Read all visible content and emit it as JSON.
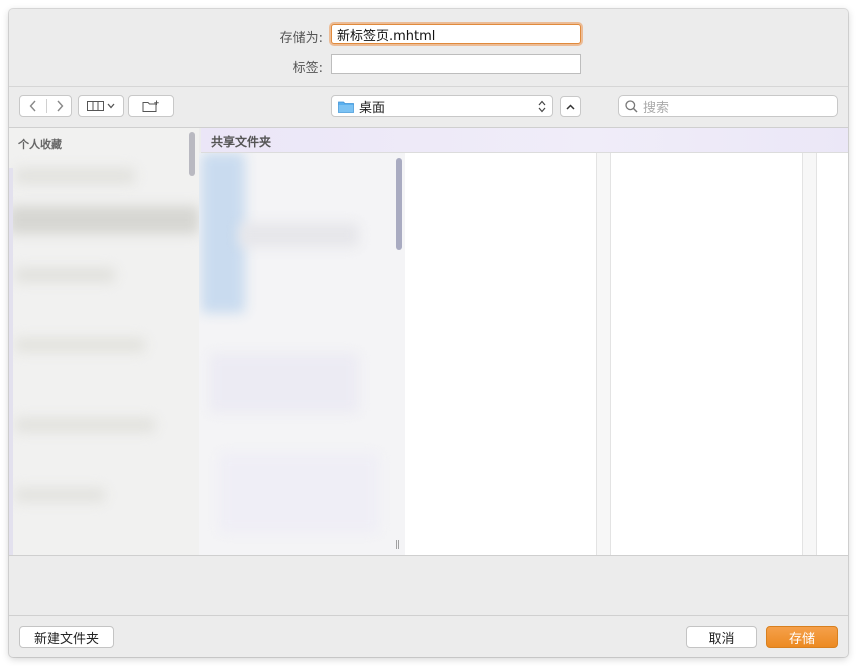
{
  "save_dialog": {
    "save_as_label": "存储为:",
    "save_as_value": "新标签页.mhtml",
    "tags_label": "标签:",
    "tags_value": ""
  },
  "toolbar": {
    "location": "桌面",
    "search_placeholder": "搜索"
  },
  "sidebar": {
    "section_title": "个人收藏"
  },
  "browser": {
    "shared_folder_header": "共享文件夹"
  },
  "footer": {
    "new_folder_label": "新建文件夹",
    "cancel_label": "取消",
    "save_label": "存储"
  },
  "colors": {
    "accent": "#ec8a22",
    "focus_ring": "#e08a3c",
    "folder_icon": "#4aa3e8"
  }
}
